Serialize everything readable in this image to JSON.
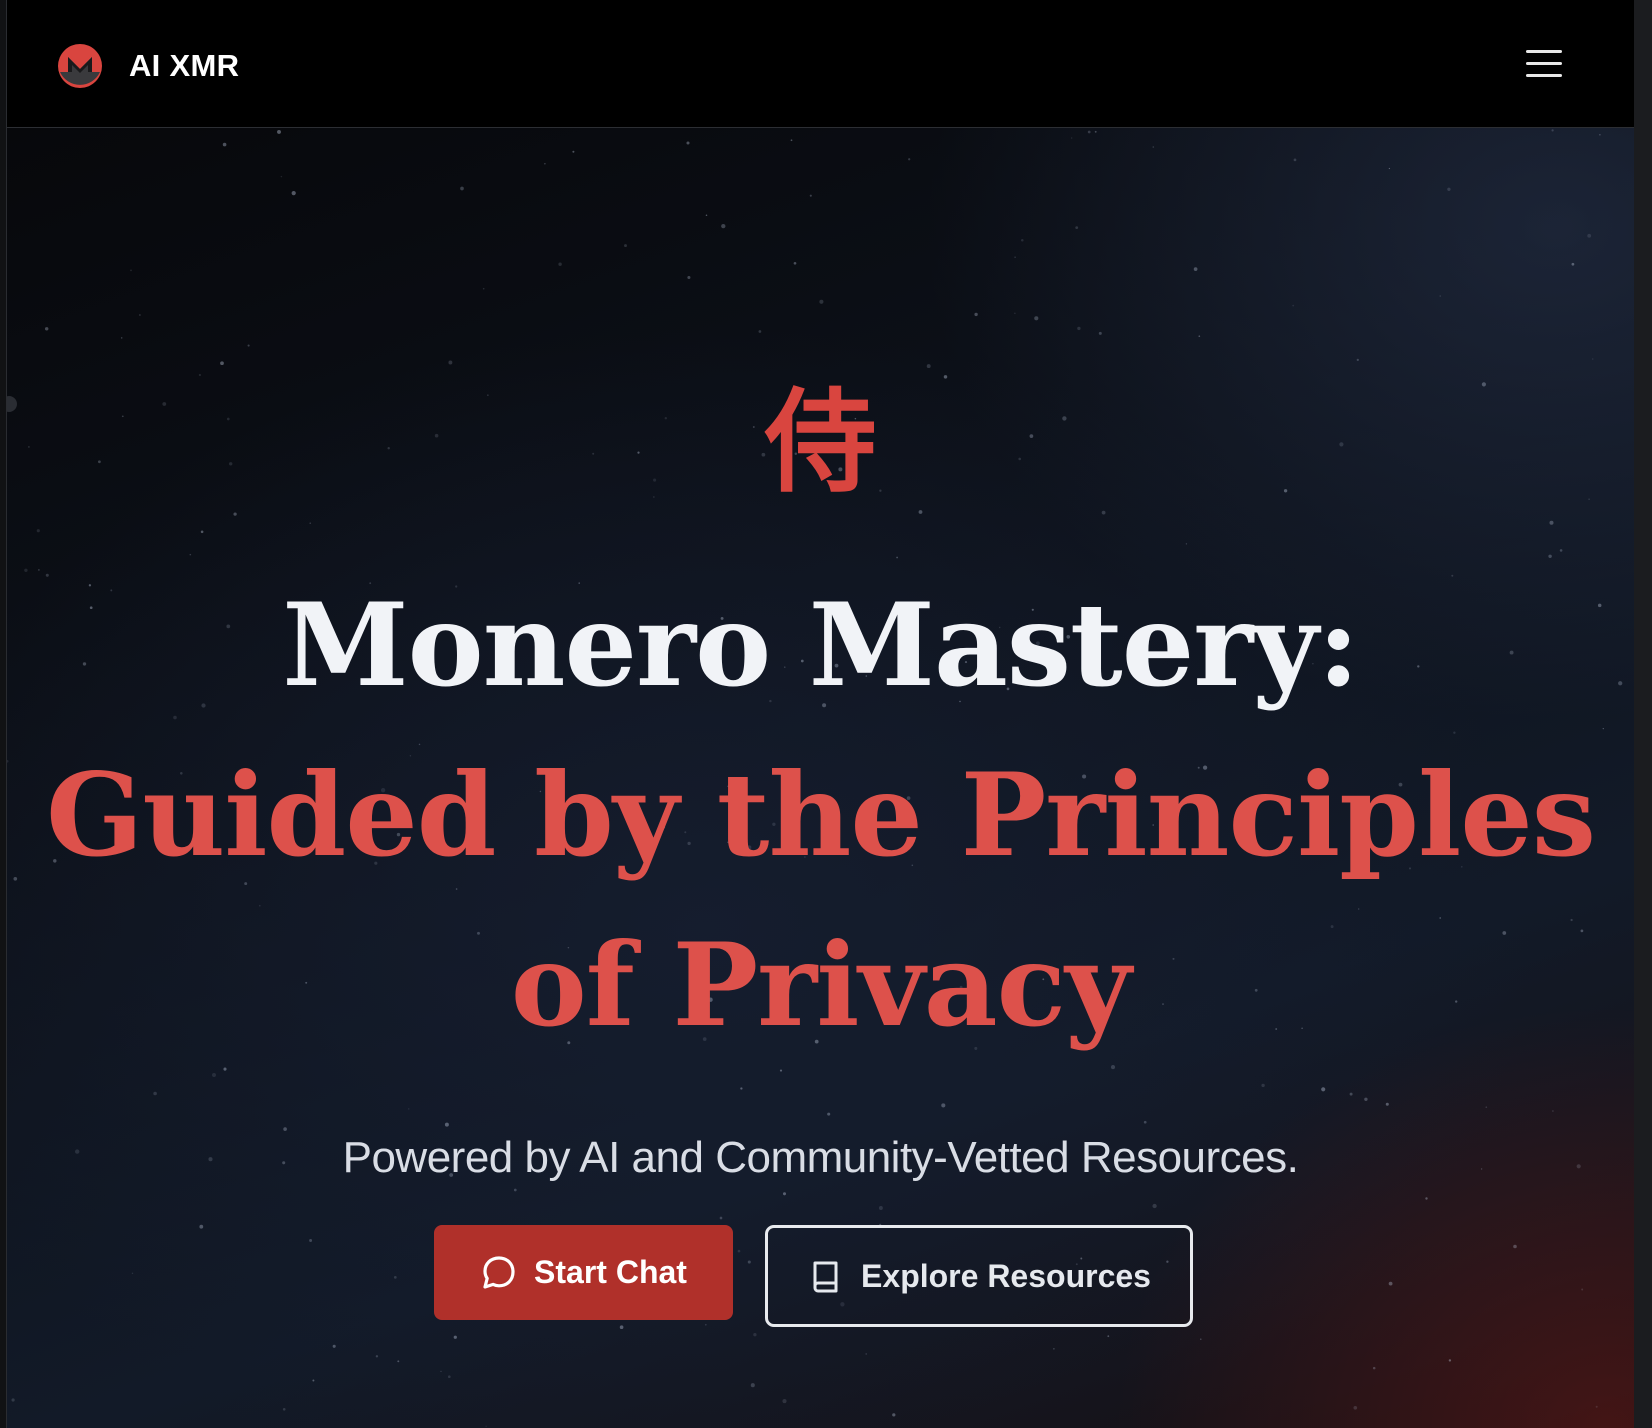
{
  "navbar": {
    "brand_name": "AI XMR",
    "logo_icon": "monero-logo-icon",
    "menu_icon": "hamburger-menu-icon"
  },
  "hero": {
    "kanji": "侍",
    "headline_line1": "Monero Mastery:",
    "headline_line2": "Guided by the Principles",
    "headline_line3": "of Privacy",
    "subtitle": "Powered by AI and Community-Vetted Resources.",
    "primary_button": {
      "label": "Start Chat",
      "icon": "chat-bubble-icon"
    },
    "secondary_button": {
      "label": "Explore Resources",
      "icon": "book-icon"
    }
  },
  "colors": {
    "accent_red": "#d9453f",
    "button_red": "#b0302a",
    "navbar_bg": "#000000",
    "text_light": "#f1f3f7"
  }
}
